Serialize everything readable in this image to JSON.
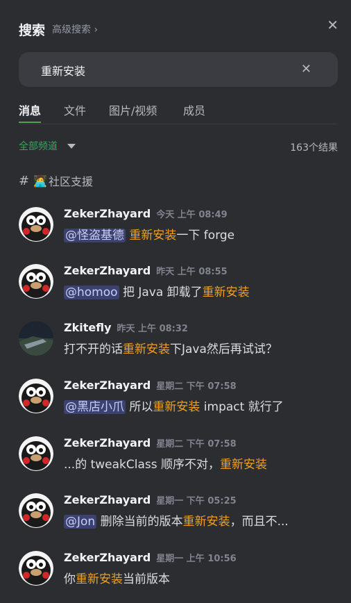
{
  "header": {
    "title": "搜索",
    "advanced": "高级搜索 ›",
    "close": "✕"
  },
  "search": {
    "value": "重新安装",
    "clear": "✕"
  },
  "tabs": [
    {
      "label": "消息"
    },
    {
      "label": "文件"
    },
    {
      "label": "图片/视频"
    },
    {
      "label": "成员"
    }
  ],
  "filter": {
    "label": "全部频道"
  },
  "result_count": "163个结果",
  "channel": {
    "hash": "#",
    "emoji": "🧑‍💻",
    "name": "社区支援"
  },
  "colors": {
    "highlight": "#f0a020",
    "accent_green": "#3ba55c",
    "mention_bg": "#3c4270"
  },
  "messages": [
    {
      "author": "ZekerZhayard",
      "time": "今天 上午 08:49",
      "mention": "@怪盗基德",
      "pre": " ",
      "highlight": "重新安装",
      "post": "一下 forge"
    },
    {
      "author": "ZekerZhayard",
      "time": "昨天 上午 08:55",
      "mention": "@homoo",
      "pre": " 把 Java 卸载了",
      "highlight": "重新安装",
      "post": ""
    },
    {
      "author": "Zkitefly",
      "time": "昨天 上午 08:32",
      "mention": "",
      "pre": "打不开的话",
      "highlight": "重新安装",
      "post": "下Java然后再试试？"
    },
    {
      "author": "ZekerZhayard",
      "time": "星期二 下午 07:58",
      "mention": "@黑店小爪",
      "pre": " 所以",
      "highlight": "重新安装",
      "post": " impact 就行了"
    },
    {
      "author": "ZekerZhayard",
      "time": "星期二 下午 07:58",
      "mention": "",
      "pre": "...的 tweakClass 顺序不对，",
      "highlight": "重新安装",
      "post": ""
    },
    {
      "author": "ZekerZhayard",
      "time": "星期一 下午 05:25",
      "mention": "@Jon",
      "pre": " 删除当前的版本",
      "highlight": "重新安装",
      "post": "，而且不..."
    },
    {
      "author": "ZekerZhayard",
      "time": "星期一 上午 10:56",
      "mention": "",
      "pre": "你",
      "highlight": "重新安装",
      "post": "当前版本"
    }
  ]
}
